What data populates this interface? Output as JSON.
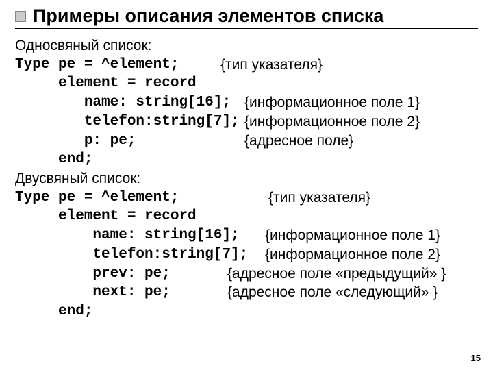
{
  "title": "Примеры описания элементов списка",
  "section1": "Односвяный список:",
  "l1a": "Type pe = ^element;",
  "l1b": "{тип указателя}",
  "l2a": "     element = record",
  "l3a": "        name: string[16];",
  "l3b": "{информационное поле 1}",
  "l4a": "        telefon:string[7];",
  "l4b": "{информационное поле 2}",
  "l5a": "        p: pe;",
  "l5b": "{адресное поле}",
  "l6a": "     end;",
  "section2": "Двусвяный список:",
  "m1a": "Type pe = ^element;",
  "m1b": "{тип указателя}",
  "m2a": "     element = record",
  "m3a": "         name: string[16];",
  "m3b": "{информационное поле 1}",
  "m4a": "         telefon:string[7];",
  "m4b": "{информационное поле 2}",
  "m5a": "         prev: pe;",
  "m5b": "{адресное поле «предыдущий» }",
  "m6a": "         next: pe;",
  "m6b": "{адресное поле «следующий» }",
  "m7a": "     end;",
  "pagenum": "15"
}
